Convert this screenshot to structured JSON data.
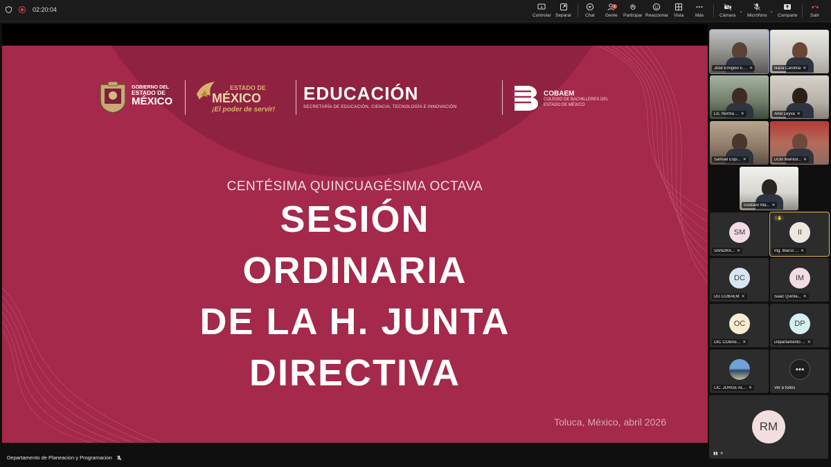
{
  "topbar": {
    "timer": "02:20:04",
    "buttons": [
      {
        "label": "Controlar",
        "icon": "remote-control-icon"
      },
      {
        "label": "Separar",
        "icon": "popout-icon"
      },
      {
        "label": "Chat",
        "icon": "chat-icon"
      },
      {
        "label": "Gente",
        "icon": "people-icon",
        "badge": "1"
      },
      {
        "label": "Participar",
        "icon": "raise-hand-icon"
      },
      {
        "label": "Reaccionar",
        "icon": "react-icon"
      },
      {
        "label": "Vista",
        "icon": "view-icon"
      },
      {
        "label": "Más",
        "icon": "more-icon"
      },
      {
        "label": "Cámara",
        "icon": "camera-off-icon"
      },
      {
        "label": "Micrófono",
        "icon": "mic-off-icon"
      },
      {
        "label": "Comparte",
        "icon": "share-icon"
      },
      {
        "label": "Salir",
        "icon": "leave-icon"
      }
    ]
  },
  "slide": {
    "logos": {
      "gobierno_small": "GOBIERNO DEL",
      "gobierno_mid": "ESTADO DE",
      "gobierno_large": "MÉXICO",
      "estado_small": "ESTADO DE",
      "estado_large": "MÉXICO",
      "estado_tagline": "¡El poder de servir!",
      "educacion_title": "EDUCACIÓN",
      "educacion_sub": "SECRETARÍA DE EDUCACIÓN, CIENCIA, TECNOLOGÍA E INNOVACIÓN",
      "cobaem_title": "COBAEM",
      "cobaem_sub1": "COLEGIO DE BACHILLERES DEL",
      "cobaem_sub2": "ESTADO DE MÉXICO"
    },
    "subtitle": "CENTÉSIMA QUINCUAGÉSIMA OCTAVA",
    "title_lines": [
      "SESIÓN",
      "ORDINARIA",
      "DE LA H. JUNTA",
      "DIRECTIVA"
    ],
    "place": "Toluca, México, abril 2026",
    "colors": {
      "background": "#a4294b",
      "arc": "#8f2241",
      "gold": "#d9b26a"
    }
  },
  "presenter": {
    "name": "Departamento de Planeacion y Programacion"
  },
  "participants": [
    {
      "name": "José Emigdio Es...",
      "type": "video"
    },
    {
      "name": "Iliana Carolina",
      "type": "video"
    },
    {
      "name": "Lic. Norma ...",
      "type": "video"
    },
    {
      "name": "Anel Leyva",
      "type": "video"
    },
    {
      "name": "Samuel Espi...",
      "type": "video"
    },
    {
      "name": "DGB Marisol...",
      "type": "video"
    },
    {
      "name": "Gustavo Ma...",
      "type": "video"
    },
    {
      "name": "SANDRA...",
      "initials": "SM",
      "color": "#f3dbe6"
    },
    {
      "name": "Ing. Marco ...",
      "initials": "II",
      "color": "#efe7de",
      "hand": "1"
    },
    {
      "name": "DG COBAEM",
      "initials": "DC",
      "color": "#d9e4f4"
    },
    {
      "name": "Isaac Quinta...",
      "initials": "IM",
      "color": "#f3dbe6"
    },
    {
      "name": "OIC COBAE...",
      "initials": "OC",
      "color": "#f7ecd0"
    },
    {
      "name": "Departamento ...",
      "initials": "DP",
      "color": "#d4f0f2"
    },
    {
      "name": "LIC. JORGE AL...",
      "type": "photo"
    },
    {
      "name": "Ver a todos",
      "type": "more"
    }
  ],
  "self": {
    "initials": "RM",
    "color": "#f2dede"
  }
}
